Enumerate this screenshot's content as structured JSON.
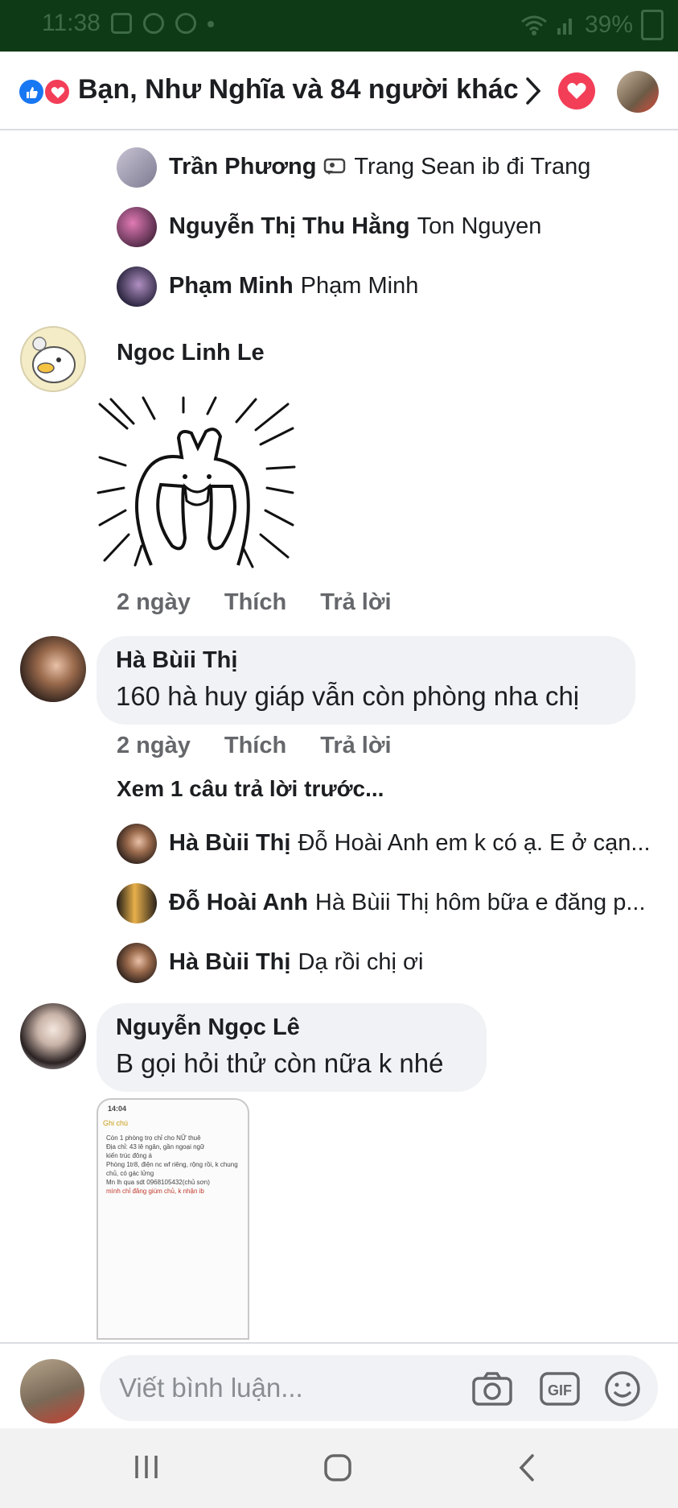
{
  "status_bar": {
    "time": "11:38",
    "battery": "39%"
  },
  "header": {
    "title": "Bạn, Như Nghĩa và 84 người khác"
  },
  "thread_top": {
    "replies": [
      {
        "name": "Trần Phương",
        "text": "Trang Sean ib đi Trang",
        "avatar_color": "#8f8fa3"
      },
      {
        "name": "Nguyễn Thị Thu Hằng",
        "text": "Ton Nguyen",
        "avatar_color": "#7a4a6a"
      },
      {
        "name": "Phạm Minh",
        "text": "Phạm Minh",
        "avatar_color": "#3f3858"
      }
    ]
  },
  "comments": [
    {
      "name": "Ngoc Linh Le",
      "time": "2 ngày",
      "like": "Thích",
      "reply": "Trả lời"
    },
    {
      "name": "Hà Bùii Thị",
      "text": "160 hà huy giáp vẫn còn phòng nha chị",
      "time": "2 ngày",
      "like": "Thích",
      "reply": "Trả lời",
      "more_replies": "Xem 1 câu trả lời trước...",
      "replies": [
        {
          "name": "Hà Bùii Thị",
          "text": "Đỗ Hoài Anh em k có ạ. E ở cạn..."
        },
        {
          "name": "Đỗ Hoài Anh",
          "text": "Hà Bùii Thị  hôm bữa e đăng p..."
        },
        {
          "name": "Hà Bùii Thị",
          "text": "Dạ rồi chị ơi"
        }
      ]
    },
    {
      "name": "Nguyễn Ngọc Lê",
      "text": "B gọi hỏi thử còn nữa k nhé",
      "screenshot": {
        "time": "14:04",
        "back": "Ghi chú",
        "lines": [
          "Còn 1 phòng trọ chỉ cho NỮ thuê",
          "Địa chỉ: 43 lê ngân, gần ngoại ngữ",
          "kiến trúc đông á",
          "Phòng 1tr8, điện nc wf riêng, rộng rồi, k chung",
          "chủ, có gác lửng",
          "Mn lh qua sdt 0968105432(chủ sơn)",
          "mình chỉ đăng giùm chủ, k nhận ib"
        ]
      }
    }
  ],
  "composer": {
    "placeholder": "Viết bình luận..."
  },
  "icons": [
    "like-reaction-icon",
    "love-reaction-icon",
    "chevron-right-icon",
    "heart-icon",
    "camera-icon",
    "gif-icon",
    "emoji-icon",
    "recent-apps-icon",
    "home-icon",
    "back-icon"
  ],
  "colors": {
    "facebook_blue": "#1877f2",
    "love_red": "#f33e58",
    "bubble_gray": "#f0f2f5",
    "meta_gray": "#65676b",
    "status_bar_green": "#0f3a16"
  }
}
